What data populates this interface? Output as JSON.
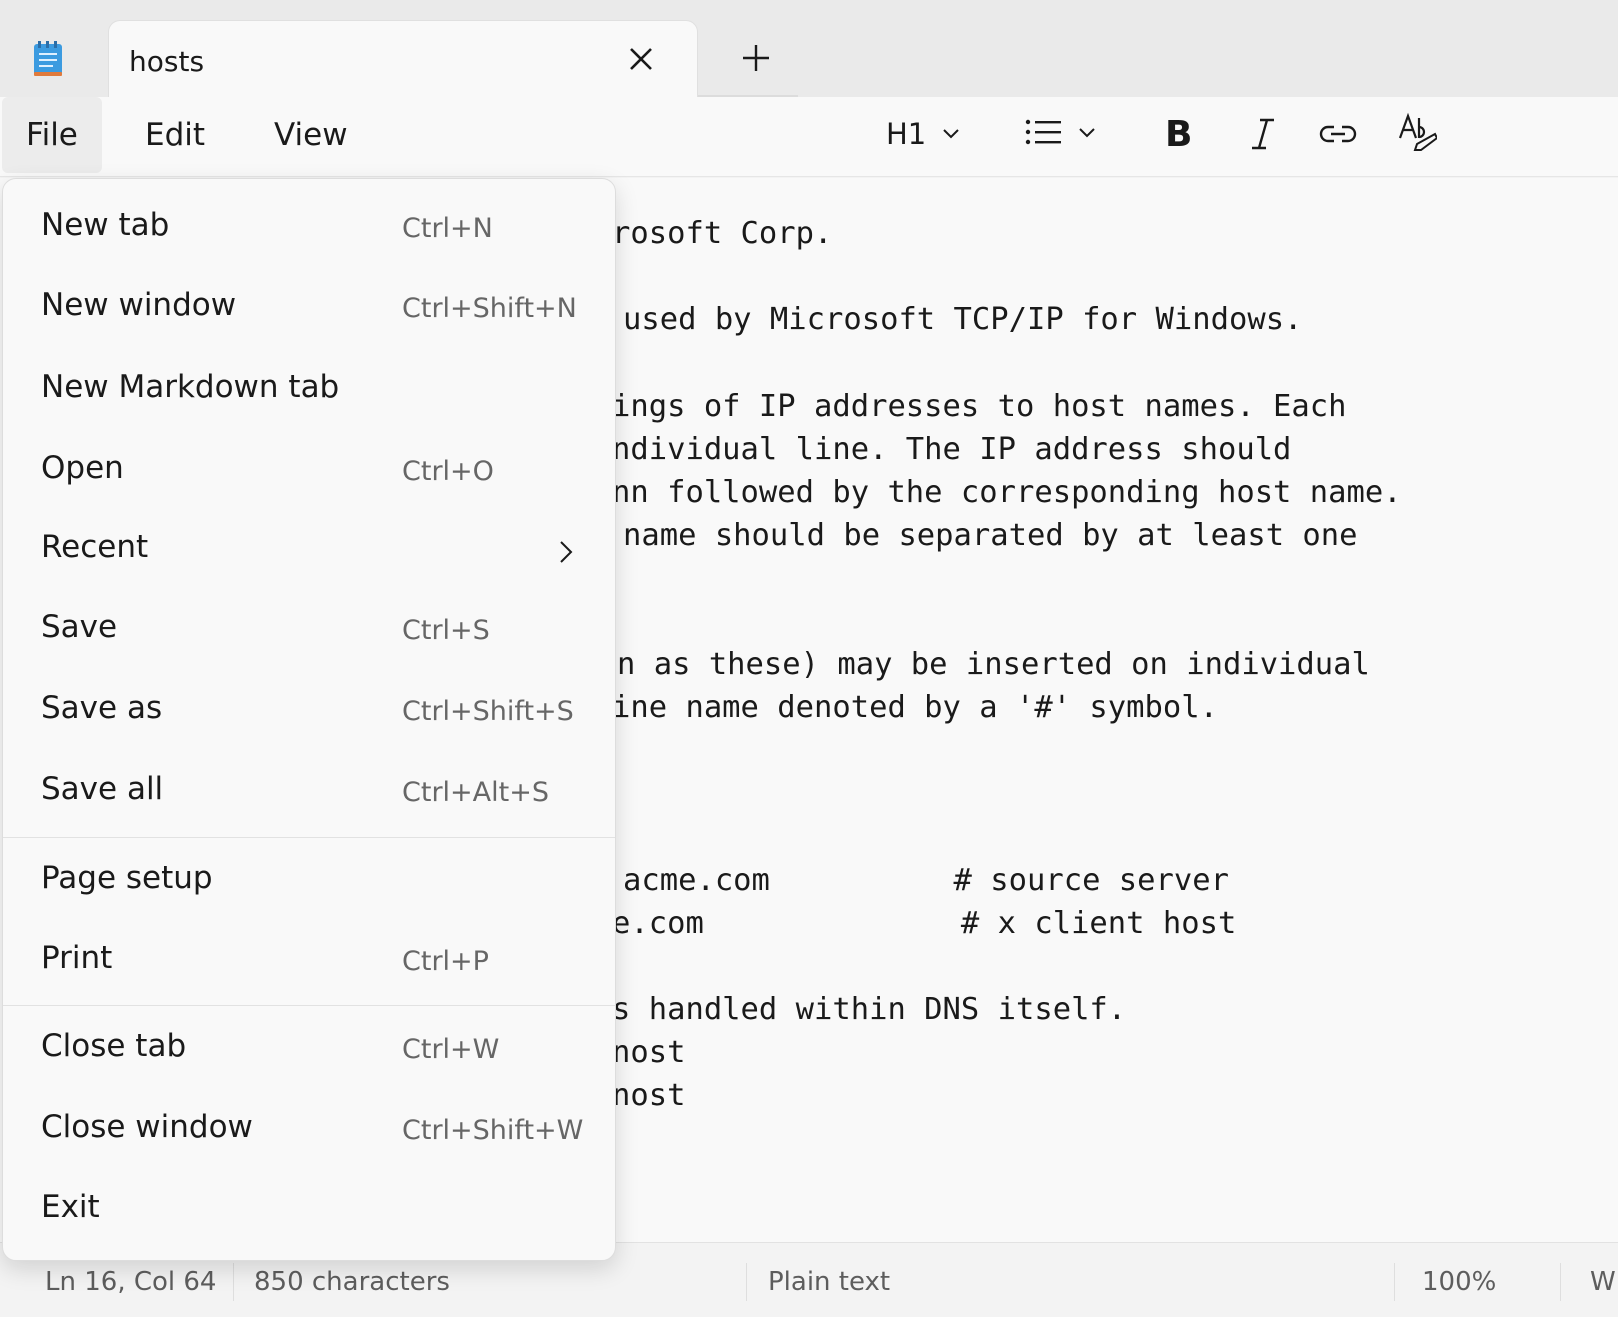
{
  "app": {
    "icon": "notepad-icon",
    "tab_title": "hosts"
  },
  "menubar": {
    "file": "File",
    "edit": "Edit",
    "view": "View"
  },
  "toolbar": {
    "heading": "H1",
    "bold": "B"
  },
  "editor_lines": [
    "rosoft Corp.",
    "used by Microsoft TCP/IP for Windows.",
    "ings of IP addresses to host names. Each",
    "ndividual line. The IP address should",
    "nn followed by the corresponding host name.",
    "name should be separated by at least one",
    "n as these) may be inserted on individual",
    "ine name denoted by a '#' symbol.",
    "acme.com          # source server",
    "e.com              # x client host",
    "s handled within DNS itself.",
    "nost",
    "nost"
  ],
  "file_menu": {
    "items": [
      {
        "label": "New tab",
        "shortcut": "Ctrl+N"
      },
      {
        "label": "New window",
        "shortcut": "Ctrl+Shift+N"
      },
      {
        "label": "New Markdown tab",
        "shortcut": ""
      },
      {
        "label": "Open",
        "shortcut": "Ctrl+O"
      },
      {
        "label": "Recent",
        "shortcut": ""
      },
      {
        "label": "Save",
        "shortcut": "Ctrl+S"
      },
      {
        "label": "Save as",
        "shortcut": "Ctrl+Shift+S"
      },
      {
        "label": "Save all",
        "shortcut": "Ctrl+Alt+S"
      },
      {
        "label": "Page setup",
        "shortcut": ""
      },
      {
        "label": "Print",
        "shortcut": "Ctrl+P"
      },
      {
        "label": "Close tab",
        "shortcut": "Ctrl+W"
      },
      {
        "label": "Close window",
        "shortcut": "Ctrl+Shift+W"
      },
      {
        "label": "Exit",
        "shortcut": ""
      }
    ]
  },
  "statusbar": {
    "position": "Ln 16, Col 64",
    "characters": "850 characters",
    "format": "Plain text",
    "zoom": "100%",
    "line_ending": "W"
  },
  "colors": {
    "menu_bg": "#f9f9f9",
    "titlebar_bg": "#eaeaea",
    "app_icon_blue": "#2f8fd6"
  }
}
